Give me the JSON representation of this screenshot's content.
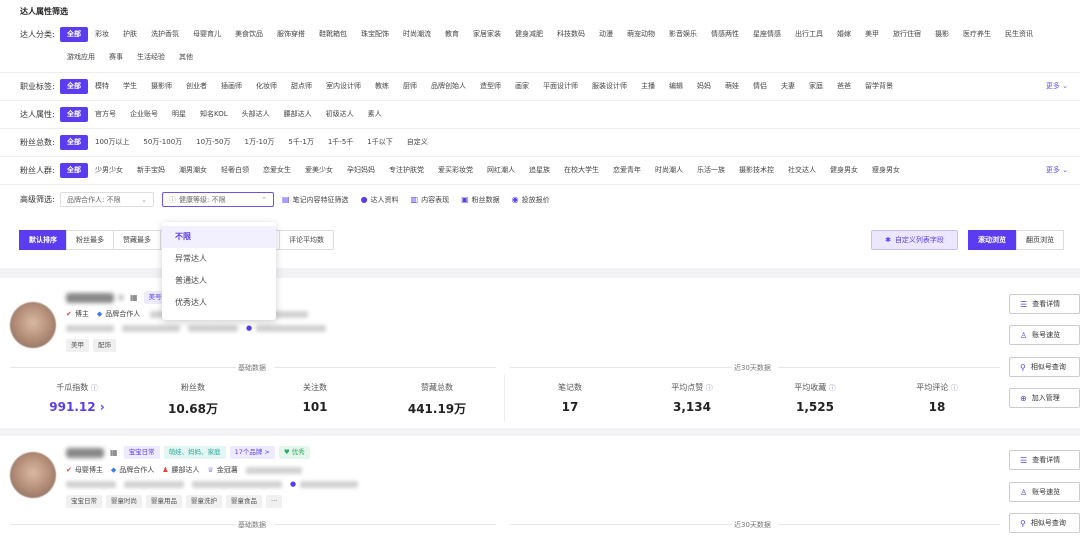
{
  "filters": {
    "title": "达人属性筛选",
    "category": {
      "label": "达人分类:",
      "options": [
        "全部",
        "彩妆",
        "护肤",
        "洗护香氛",
        "母婴育儿",
        "美食饮品",
        "服饰穿搭",
        "鞋靴箱包",
        "珠宝配饰",
        "时尚潮流",
        "教育",
        "家居家装",
        "健身减肥",
        "科技数码",
        "动漫",
        "萌宠动物",
        "影音娱乐",
        "情感两性",
        "星座情感",
        "出行工具",
        "婚嫁",
        "美甲",
        "旅行住宿",
        "摄影",
        "医疗养生",
        "民生资讯",
        "游戏应用",
        "赛事",
        "生活经验",
        "其他"
      ]
    },
    "profession": {
      "label": "职业标签:",
      "options": [
        "全部",
        "模特",
        "学生",
        "摄影师",
        "创业者",
        "插画师",
        "化妆师",
        "甜点师",
        "室内设计师",
        "教练",
        "厨师",
        "品牌创始人",
        "造型师",
        "画家",
        "平面设计师",
        "服装设计师",
        "主播",
        "编辑",
        "妈妈",
        "萌娃",
        "情侣",
        "夫妻",
        "家庭",
        "爸爸",
        "留学背景"
      ],
      "more": "更多 ⌄"
    },
    "attribute": {
      "label": "达人属性:",
      "options": [
        "全部",
        "官方号",
        "企业账号",
        "明星",
        "知名KOL",
        "头部达人",
        "腰部达人",
        "初级达人",
        "素人"
      ]
    },
    "fans_total": {
      "label": "粉丝总数:",
      "options": [
        "全部",
        "100万以上",
        "50万-100万",
        "10万-50万",
        "1万-10万",
        "5千-1万",
        "1千-5千",
        "1千以下",
        "自定义"
      ]
    },
    "fans_group": {
      "label": "粉丝人群:",
      "options": [
        "全部",
        "少男少女",
        "新手宝妈",
        "潮男潮女",
        "轻奢白领",
        "恋爱女生",
        "爱美少女",
        "孕妇妈妈",
        "专注护肤党",
        "爱买彩妆党",
        "网红潮人",
        "追星族",
        "在校大学生",
        "恋爱青年",
        "时尚潮人",
        "乐活一族",
        "摄影技术控",
        "社交达人",
        "健身男女",
        "瘦身男女"
      ],
      "more": "更多 ⌄"
    },
    "advanced": {
      "label": "高级筛选:",
      "brand_select": "品牌合作人: 不限",
      "health_select": "健康等级: 不限",
      "links": [
        "笔记内容特征筛选",
        "达人资料",
        "内容表现",
        "粉丝数据",
        "投放报价"
      ]
    },
    "health_dropdown": [
      "不限",
      "异常达人",
      "普通达人",
      "优秀达人"
    ]
  },
  "sort": {
    "buttons": [
      "默认排序",
      "粉丝最多",
      "赞藏最多",
      "",
      "评论平均数"
    ],
    "custom_fields": "自定义列表字段",
    "view_modes": [
      "滚动浏览",
      "翻页浏览"
    ]
  },
  "cards": [
    {
      "name_tag": "美号",
      "line1": [
        "博主",
        "品牌合作人"
      ],
      "chips": [
        "美甲",
        "配饰"
      ],
      "section_basic": "基础数据",
      "section_30d": "近30天数据",
      "metrics": [
        {
          "label": "千瓜指数",
          "value": "991.12"
        },
        {
          "label": "粉丝数",
          "value": "10.68万"
        },
        {
          "label": "关注数",
          "value": "101"
        },
        {
          "label": "赞藏总数",
          "value": "441.19万"
        },
        {
          "label": "笔记数",
          "value": "17"
        },
        {
          "label": "平均点赞",
          "value": "3,134"
        },
        {
          "label": "平均收藏",
          "value": "1,525"
        },
        {
          "label": "平均评论",
          "value": "18"
        }
      ],
      "actions": [
        "查看详情",
        "账号速览",
        "相似号查询",
        "加入管理"
      ]
    },
    {
      "name_chips": [
        "宝宝日常",
        "萌娃、妈妈、家庭",
        "17个品牌 >",
        "优秀"
      ],
      "line1": [
        "母婴博主",
        "品牌合作人",
        "腰部达人",
        "金冠薯"
      ],
      "chips": [
        "宝宝日常",
        "婴童时尚",
        "婴童用品",
        "婴童洗护",
        "婴童食品",
        "···"
      ],
      "section_basic": "基础数据",
      "section_30d": "近30天数据",
      "actions": [
        "查看详情",
        "账号速览",
        "相似号查询"
      ]
    }
  ],
  "colors": {
    "accent": "#5b3cf0",
    "page_bg": "#f2f2f5"
  }
}
